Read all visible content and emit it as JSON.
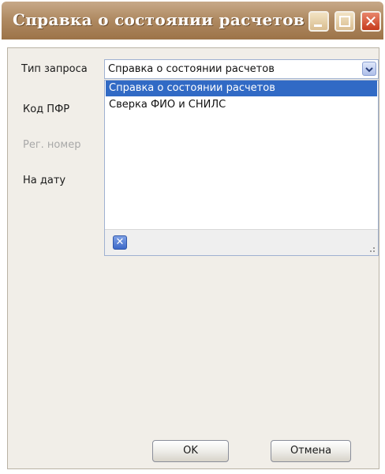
{
  "window": {
    "title": "Справка о состоянии расчетов"
  },
  "form": {
    "type_label": "Тип запроса",
    "kod_label": "Код ПФР",
    "reg_label": "Рег. номер",
    "date_label": "На дату",
    "type_value": "Справка о состоянии расчетов"
  },
  "dropdown": {
    "items": [
      {
        "label": "Справка о состоянии расчетов",
        "selected": true
      },
      {
        "label": "Сверка ФИО и СНИЛС",
        "selected": false
      }
    ]
  },
  "buttons": {
    "ok": "OK",
    "cancel": "Отмена"
  },
  "colors": {
    "titlebar": "#b08b63",
    "selection": "#316ac5",
    "close_button": "#c63a1c"
  }
}
